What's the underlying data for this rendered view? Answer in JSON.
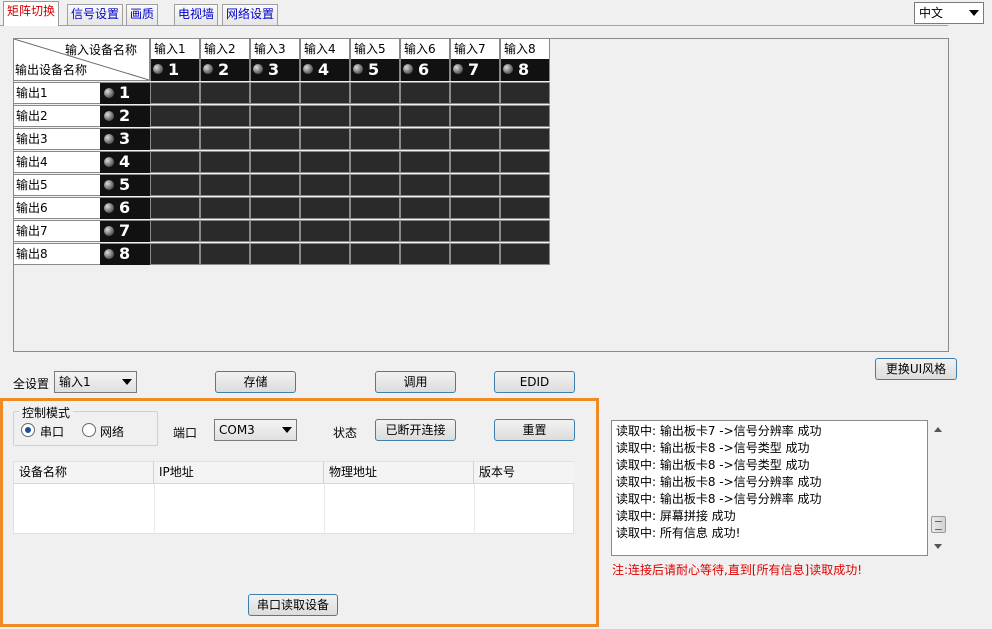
{
  "tabs": [
    {
      "label": "矩阵切换",
      "active": true
    },
    {
      "label": "信号设置",
      "active": false
    },
    {
      "label": "画质",
      "active": false
    },
    {
      "label": "电视墙",
      "active": false
    },
    {
      "label": "网络设置",
      "active": false
    }
  ],
  "language": "中文",
  "matrix": {
    "corner_input_label": "输入设备名称",
    "corner_output_label": "输出设备名称",
    "inputs": [
      {
        "label": "输入1",
        "num": "1"
      },
      {
        "label": "输入2",
        "num": "2"
      },
      {
        "label": "输入3",
        "num": "3"
      },
      {
        "label": "输入4",
        "num": "4"
      },
      {
        "label": "输入5",
        "num": "5"
      },
      {
        "label": "输入6",
        "num": "6"
      },
      {
        "label": "输入7",
        "num": "7"
      },
      {
        "label": "输入8",
        "num": "8"
      }
    ],
    "outputs": [
      {
        "label": "输出1",
        "num": "1"
      },
      {
        "label": "输出2",
        "num": "2"
      },
      {
        "label": "输出3",
        "num": "3"
      },
      {
        "label": "输出4",
        "num": "4"
      },
      {
        "label": "输出5",
        "num": "5"
      },
      {
        "label": "输出6",
        "num": "6"
      },
      {
        "label": "输出7",
        "num": "7"
      },
      {
        "label": "输出8",
        "num": "8"
      }
    ]
  },
  "controls": {
    "all_set_label": "全设置",
    "all_set_value": "输入1",
    "save_label": "存储",
    "recall_label": "调用",
    "edid_label": "EDID",
    "change_ui_label": "更换UI风格"
  },
  "connection": {
    "mode_title": "控制模式",
    "mode_serial": "串口",
    "mode_network": "网络",
    "port_label": "端口",
    "port_value": "COM3",
    "status_label": "状态",
    "status_value": "已断开连接",
    "reset_label": "重置",
    "read_device_label": "串口读取设备"
  },
  "device_table": {
    "columns": [
      "设备名称",
      "IP地址",
      "物理地址",
      "版本号"
    ],
    "rows": []
  },
  "log": {
    "lines": [
      "读取中: 输出板卡7 ->信号分辨率 成功",
      "读取中: 输出板卡8 ->信号类型 成功",
      "读取中: 输出板卡8 ->信号类型 成功",
      "读取中: 输出板卡8 ->信号分辨率 成功",
      "读取中: 输出板卡8 ->信号分辨率 成功",
      "读取中: 屏幕拼接 成功",
      "读取中: 所有信息 成功!"
    ],
    "note": "注:连接后请耐心等待,直到[所有信息]读取成功!"
  },
  "colors": {
    "highlight_border": "#f08a24",
    "active_tab_text": "#d40000",
    "tab_text": "#0000cc",
    "note_text": "#e00000",
    "cell_bg": "#2a2a2a"
  }
}
